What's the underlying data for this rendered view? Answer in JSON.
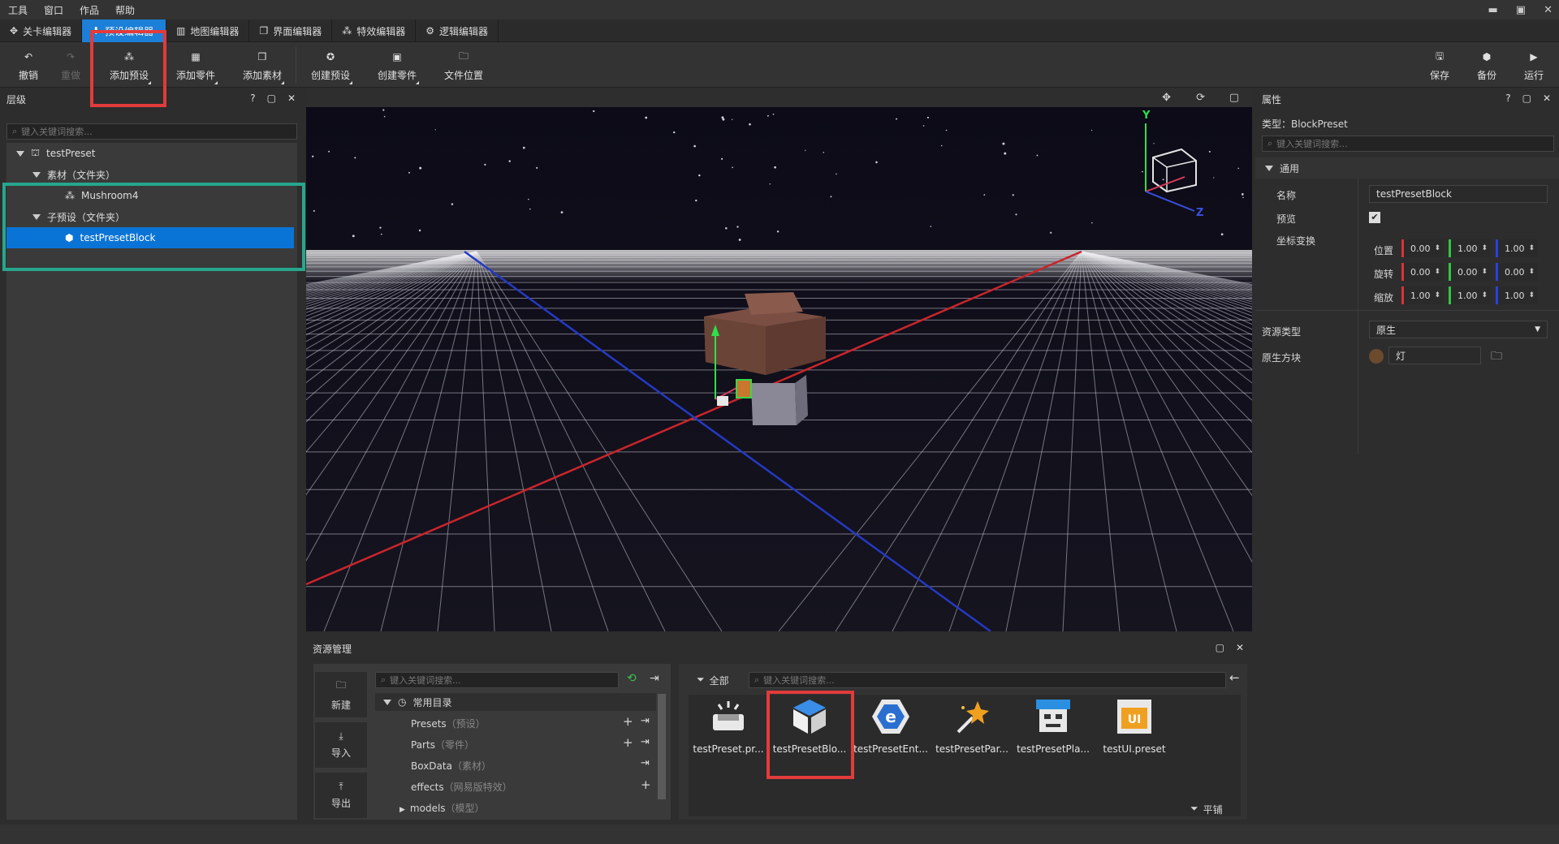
{
  "menubar": {
    "items": [
      "工具",
      "窗口",
      "作品",
      "帮助"
    ],
    "window_controls": [
      "▬",
      "▣",
      "✕"
    ]
  },
  "tabs": [
    {
      "label": "关卡编辑器",
      "icon": "crosshair-icon"
    },
    {
      "label": "预设编辑器",
      "icon": "download-arrow-icon",
      "active": true
    },
    {
      "label": "地图编辑器",
      "icon": "map-icon"
    },
    {
      "label": "界面编辑器",
      "icon": "window-icon"
    },
    {
      "label": "特效编辑器",
      "icon": "particles-icon"
    },
    {
      "label": "逻辑编辑器",
      "icon": "gear-icon"
    }
  ],
  "toolbar": {
    "undo": "撤销",
    "redo": "重做",
    "add_preset": "添加预设",
    "add_part": "添加零件",
    "add_asset": "添加素材",
    "create_preset": "创建预设",
    "create_part": "创建零件",
    "file_location": "文件位置",
    "save": "保存",
    "backup": "备份",
    "run": "运行"
  },
  "hierarchy": {
    "title": "层级",
    "tools": [
      "?",
      "▢",
      "✕"
    ],
    "search_placeholder": "键入关键词搜索...",
    "rows": [
      "testPreset",
      "素材（文件夹）",
      "Mushroom4",
      "子预设（文件夹）",
      "testPresetBlock"
    ]
  },
  "properties": {
    "title": "属性",
    "tools": [
      "?",
      "▢",
      "✕"
    ],
    "type_text": "类型：BlockPreset",
    "search_placeholder": "键入关键词搜索...",
    "section": "通用",
    "name_label": "名称",
    "name_value": "testPresetBlock",
    "preview_label": "预览",
    "preview_checked": true,
    "transform_label": "坐标变换",
    "position_label": "位置",
    "rotation_label": "旋转",
    "scale_label": "缩放",
    "position": [
      "0.00",
      "1.00",
      "1.00"
    ],
    "rotation": [
      "0.00",
      "0.00",
      "0.00"
    ],
    "scale": [
      "1.00",
      "1.00",
      "1.00"
    ],
    "resource_type_label": "资源类型",
    "resource_type_value": "原生",
    "native_block_label": "原生方块",
    "native_block_value": "灯"
  },
  "viewport": {
    "gizmo_axes": [
      "Y",
      "Z"
    ]
  },
  "assets_panel": {
    "title": "资源管理",
    "tools": [
      "▢",
      "✕"
    ],
    "side_buttons": [
      "新建",
      "导入",
      "导出"
    ],
    "tree_search_placeholder": "键入关键词搜索...",
    "tree_root": "常用目录",
    "tree": [
      {
        "name": "Presets",
        "note": "（预设）"
      },
      {
        "name": "Parts",
        "note": "（零件）"
      },
      {
        "name": "BoxData",
        "note": "（素材）"
      },
      {
        "name": "effects",
        "note": "（网易版特效）"
      },
      {
        "name": "models",
        "note": "（模型）"
      }
    ],
    "filter_label": "全部",
    "grid_search_placeholder": "键入关键词搜索...",
    "items": [
      "testPreset.pr...",
      "testPresetBlo...",
      "testPresetEnt...",
      "testPresetPar...",
      "testPresetPla...",
      "testUI.preset"
    ],
    "flat_label": "平铺"
  },
  "colors": {
    "accent": "#1c7fd8",
    "highlight_red": "#e23b3b",
    "highlight_green": "#27a68d"
  }
}
